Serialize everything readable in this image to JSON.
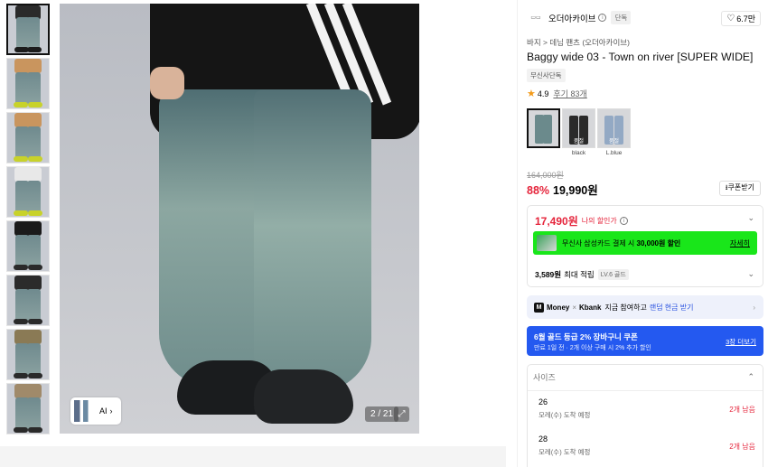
{
  "gallery": {
    "thumbnails": [
      {
        "label": "thumb 1",
        "top": "#2a2a2a",
        "shoe": "#1c1c1c"
      },
      {
        "label": "thumb 2",
        "top": "#c9955e",
        "shoe": "#c8d22a"
      },
      {
        "label": "thumb 3",
        "top": "#c9955e",
        "shoe": "#c8d22a"
      },
      {
        "label": "thumb 4",
        "top": "#e8e8e8",
        "shoe": "#c8d22a"
      },
      {
        "label": "thumb 5",
        "top": "#1b1b1b",
        "shoe": "#2a2a2a"
      },
      {
        "label": "thumb 6",
        "top": "#2b2b2b",
        "shoe": "#2a2a2a"
      },
      {
        "label": "thumb 7",
        "top": "#8a7a55",
        "shoe": "#2a2a2a"
      },
      {
        "label": "thumb 8",
        "top": "#a08a6a",
        "shoe": "#2a2a2a"
      }
    ],
    "ai_label": "AI",
    "counter": "2 / 21",
    "expand_icon": "⤢"
  },
  "brand": {
    "name": "오더아카이브",
    "info_icon": "i",
    "tag": "단독",
    "likes": "6.7만",
    "heart_icon": "♡"
  },
  "product": {
    "breadcrumb": "바지 > 데님 팬츠 (오더아카이브)",
    "title": "Baggy wide 03 - Town on river [SUPER WIDE]",
    "exclusive_badge": "무신사단독",
    "rating": "4.9",
    "reviews": "후기 83개",
    "star_icon": "★"
  },
  "swatches": [
    {
      "label": "",
      "color": "#6b8a8c",
      "soldout": ""
    },
    {
      "label": "black",
      "color": "#2a2a2a",
      "soldout": "품절"
    },
    {
      "label": "L.blue",
      "color": "#93a9c4",
      "soldout": "품절"
    }
  ],
  "price": {
    "original": "164,000원",
    "discount": "88%",
    "sale": "19,990원",
    "coupon_button": "⭳쿠폰받기"
  },
  "benefit": {
    "my_price": "17,490원",
    "my_price_label": "나의 할인가",
    "info_icon": "i",
    "card_text_pre": "무신사 삼성카드 결제 시",
    "card_text_bold": "30,000원 할인",
    "card_more": "자세히",
    "points_bold": "3,589원",
    "points_text": "최대 적립",
    "level_tag": "LV.6 골드",
    "chevron_icon": "⌄"
  },
  "kbank": {
    "m_logo": "M",
    "money": "Money",
    "times": "×",
    "kbank": "Kbank",
    "text": "지금 참여하고",
    "highlight": "랜덤 현금 받기",
    "arrow_icon": "›"
  },
  "gold_coupon": {
    "title": "6월 골드 등급 2% 장바구니 쿠폰",
    "subtitle": "만료 1일 전 · 2개 이상 구매 시 2% 추가 할인",
    "more": "3장 더보기"
  },
  "size": {
    "header": "사이즈",
    "chevron_up_icon": "⌃",
    "options": [
      {
        "name": "26",
        "eta": "모레(수) 도착 예정",
        "stock": "2개 남음"
      },
      {
        "name": "28",
        "eta": "모레(수) 도착 예정",
        "stock": "2개 남음"
      }
    ]
  }
}
